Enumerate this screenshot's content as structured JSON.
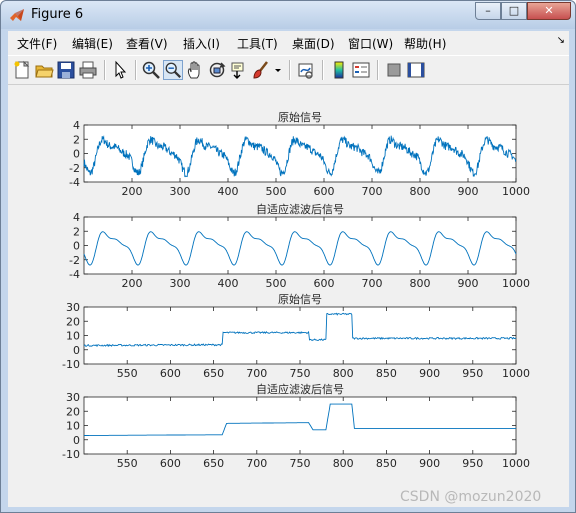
{
  "window": {
    "title": "Figure 6",
    "minimize": "–",
    "maximize": "□",
    "close": "✕"
  },
  "menu": [
    "文件(F)",
    "编辑(E)",
    "查看(V)",
    "插入(I)",
    "工具(T)",
    "桌面(D)",
    "窗口(W)",
    "帮助(H)"
  ],
  "menu_overflow": "↘",
  "toolbar": [
    "new-figure-icon",
    "open-file-icon",
    "save-icon",
    "print-icon",
    "pointer-icon",
    "zoom-in-icon",
    "zoom-out-icon",
    "pan-icon",
    "rotate-3d-icon",
    "data-cursor-icon",
    "brush-icon",
    "brush-dropdown-icon",
    "link-plot-icon",
    "colorbar-icon",
    "legend-icon",
    "hide-plot-tools-icon",
    "show-plot-tools-icon"
  ],
  "chart_data": [
    {
      "type": "line",
      "title": "原始信号",
      "xlim": [
        100,
        1000
      ],
      "ylim": [
        -4,
        4
      ],
      "xticks": [
        200,
        300,
        400,
        500,
        600,
        700,
        800,
        900,
        1000
      ],
      "yticks": [
        -4,
        -2,
        0,
        2,
        4
      ],
      "series": [
        {
          "color": "#0072bd"
        }
      ],
      "periodic": {
        "period": 100,
        "noise": 0.6
      }
    },
    {
      "type": "line",
      "title": "自适应滤波后信号",
      "xlim": [
        100,
        1000
      ],
      "ylim": [
        -4,
        4
      ],
      "xticks": [
        200,
        300,
        400,
        500,
        600,
        700,
        800,
        900,
        1000
      ],
      "yticks": [
        -4,
        -2,
        0,
        2,
        4
      ],
      "series": [
        {
          "color": "#0072bd"
        }
      ],
      "periodic": {
        "period": 100,
        "noise": 0
      }
    },
    {
      "type": "line",
      "title": "原始信号",
      "xlim": [
        500,
        1000
      ],
      "ylim": [
        -10,
        30
      ],
      "xticks": [
        550,
        600,
        650,
        700,
        750,
        800,
        850,
        900,
        950,
        1000
      ],
      "yticks": [
        -10,
        0,
        10,
        20,
        30
      ],
      "series": [
        {
          "color": "#0072bd",
          "x": [
            500,
            660,
            661,
            760,
            761,
            780,
            781,
            810,
            811,
            1000
          ],
          "y": [
            3,
            3.5,
            12,
            12,
            7,
            7,
            25,
            25,
            8,
            8
          ],
          "noise": 0.6
        }
      ]
    },
    {
      "type": "line",
      "title": "自适应滤波后信号",
      "xlim": [
        500,
        1000
      ],
      "ylim": [
        -10,
        30
      ],
      "xticks": [
        550,
        600,
        650,
        700,
        750,
        800,
        850,
        900,
        950,
        1000
      ],
      "yticks": [
        -10,
        0,
        10,
        20,
        30
      ],
      "series": [
        {
          "color": "#0072bd",
          "x": [
            500,
            660,
            665,
            760,
            765,
            780,
            785,
            810,
            813,
            1000
          ],
          "y": [
            3,
            3.5,
            11.5,
            12,
            7,
            7,
            25,
            25,
            8,
            8
          ],
          "noise": 0
        }
      ]
    }
  ],
  "watermark": "CSDN @mozun2020"
}
